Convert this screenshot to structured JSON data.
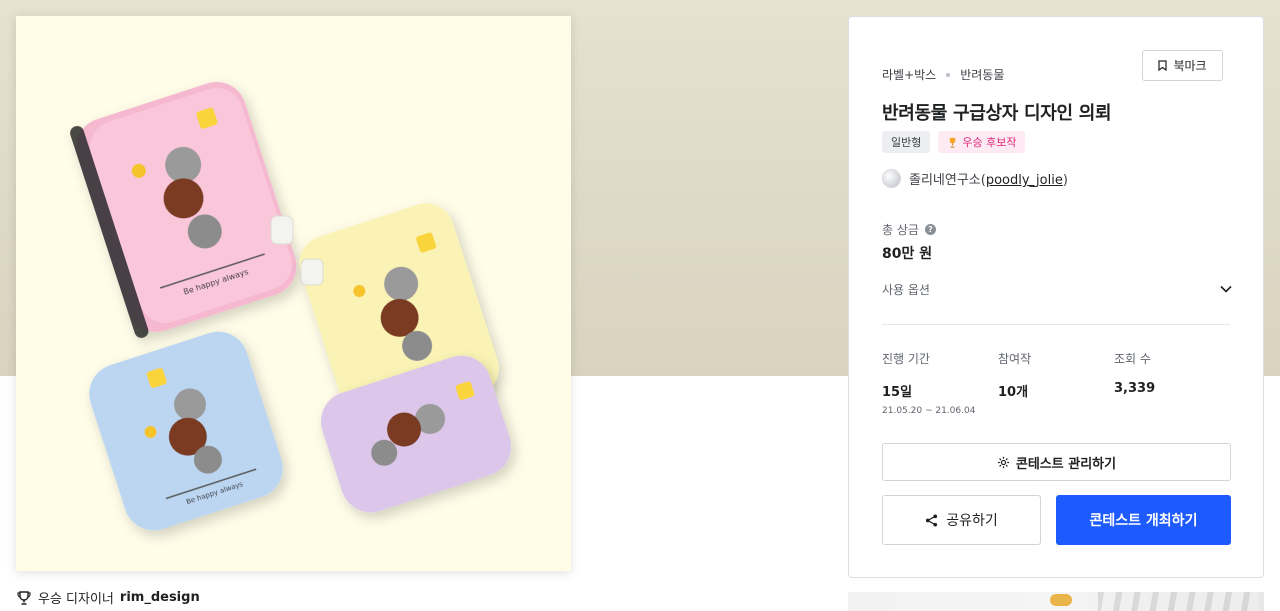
{
  "product": {
    "box_text": "Be happy always",
    "image_alt_colors": {
      "background": "#fffde8",
      "pink": "#f6b8cf",
      "yellow": "#fbf3b5",
      "blue": "#bcd6f2",
      "purple": "#dcc6ea"
    }
  },
  "winner_caption": {
    "prefix": "우승 디자이너",
    "name": "rim_design"
  },
  "card": {
    "breadcrumb": [
      "라벨+박스",
      "반려동물"
    ],
    "bookmark_label": "북마크",
    "title": "반려동물 구급상자 디자인 의뢰",
    "tags": {
      "general": "일반형",
      "winner": "우승 후보작"
    },
    "host": {
      "name": "졸리네연구소",
      "handle": "poodly_jolie"
    },
    "prize": {
      "label": "총 상금",
      "value": "80만 원"
    },
    "usage_option_label": "사용 옵션",
    "stats": {
      "period_label": "진행 기간",
      "period_value": "15일",
      "period_range": "21.05.20 ~ 21.06.04",
      "participants_label": "참여작",
      "participants_value": "10개",
      "views_label": "조회 수",
      "views_value": "3,339"
    },
    "manage_button": "콘테스트 관리하기",
    "share_button": "공유하기",
    "host_button": "콘테스트 개최하기"
  },
  "icons": {
    "bookmark": "bookmark-icon",
    "trophy": "trophy-icon",
    "gear": "gear-icon",
    "share": "share-icon",
    "chevron": "chevron-down-icon",
    "help": "help-icon"
  },
  "colors": {
    "primary": "#1e5bff",
    "winner_tag": "#e0287a"
  }
}
